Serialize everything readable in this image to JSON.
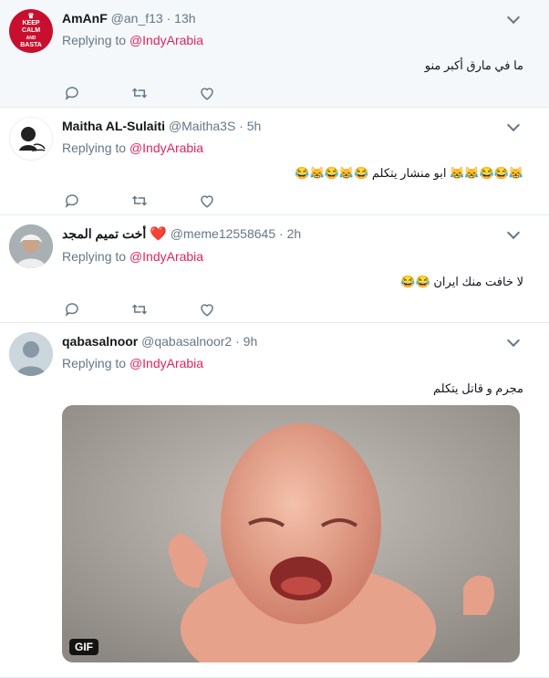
{
  "tweets": [
    {
      "name": "AmAnF",
      "handle": "@an_f13",
      "time": "13h",
      "replying_label": "Replying to",
      "replying_to": "@IndyArabia",
      "text": "ما في مارق أكبر منو",
      "avatar_text": [
        "KEEP",
        "CALM",
        "AND",
        "BASTA"
      ]
    },
    {
      "name": "Maitha AL-Sulaiti",
      "handle": "@Maitha3S",
      "time": "5h",
      "replying_label": "Replying to",
      "replying_to": "@IndyArabia",
      "text": "😹😂😂😹😹 ابو منشار يتكلم 😂😹😂😹😂"
    },
    {
      "name": "أخت تميم المجد",
      "name_emoji": "❤️",
      "handle": "@meme12558645",
      "time": "2h",
      "replying_label": "Replying to",
      "replying_to": "@IndyArabia",
      "text": "لا خافت منك ايران 😂😂"
    },
    {
      "name": "qabasalnoor",
      "handle": "@qabasalnoor2",
      "time": "9h",
      "replying_label": "Replying to",
      "replying_to": "@IndyArabia",
      "text": "مجرم و قاتل يتكلم",
      "media_badge": "GIF"
    }
  ],
  "icons": [
    "reply-icon",
    "retweet-icon",
    "like-icon",
    "chevron-down-icon"
  ],
  "colors": {
    "accent": "#e0245e",
    "muted": "#657786",
    "highlight_bg": "#f5f8fa"
  }
}
